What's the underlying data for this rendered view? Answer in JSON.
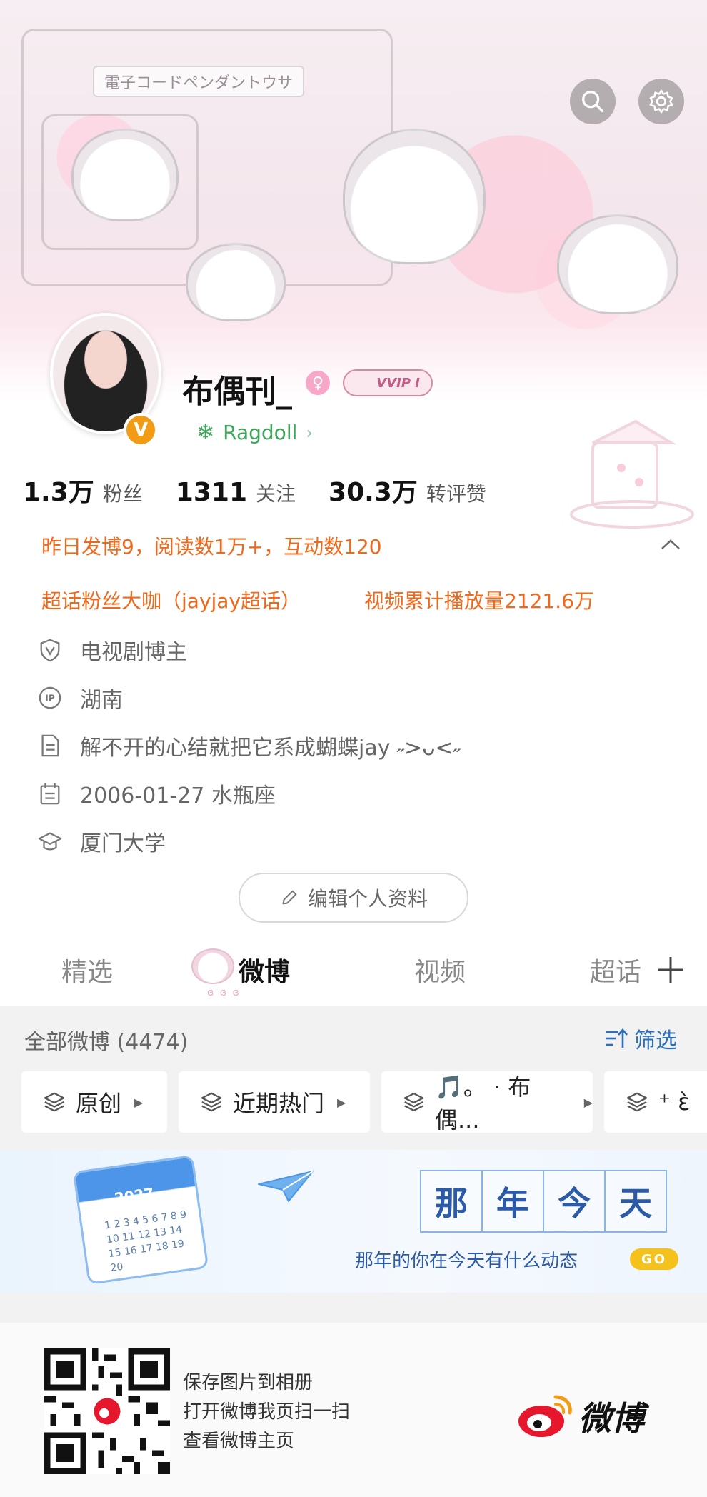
{
  "cover": {
    "caption": "電子コードペンダントウサ"
  },
  "profile": {
    "username": "布偶刊_",
    "gender_symbol": "♀",
    "vip_label": "VVIP I",
    "verified_badge": "V",
    "group_name": "Ragdoll",
    "group_icon": "❄",
    "group_chevron": "›"
  },
  "stats": [
    {
      "value": "1.3万",
      "label": "粉丝"
    },
    {
      "value": "1311",
      "label": "关注"
    },
    {
      "value": "30.3万",
      "label": "转评赞"
    }
  ],
  "highlights": {
    "yesterday": "昨日发博9，阅读数1万+，互动数120",
    "super_topic": "超话粉丝大咖（jayjay超话）",
    "video_plays": "视频累计播放量2121.6万"
  },
  "info": {
    "category": "电视剧博主",
    "location": "湖南",
    "bio": "解不开的心结就把它系成蝴蝶jay ˶>ᴗ<˶",
    "birthday": "2006-01-27 水瓶座",
    "school": "厦门大学"
  },
  "edit_button": "编辑个人资料",
  "tabs": [
    "精选",
    "微博",
    "视频",
    "超话"
  ],
  "tab_deco_text": "ɞ ɞ ɞ",
  "feed": {
    "count_label": "全部微博 (4474)",
    "filter_label": "筛选",
    "chips": [
      "原创",
      "近期热门",
      "🎵。 · 布偶...",
      "⁺ ɛ̀"
    ]
  },
  "banner": {
    "year": "2027",
    "calendar_numbers": "1 2 3 4 5 6 7 8 9 10 11 12 13 14 15 16 17 18 19 20",
    "title_chars": [
      "那",
      "年",
      "今",
      "天"
    ],
    "subtitle": "那年的你在今天有什么动态",
    "go_label": "GO"
  },
  "qr_card": {
    "lines": [
      "保存图片到相册",
      "打开微博我页扫一扫",
      "查看微博主页"
    ],
    "logo_text": "微博"
  },
  "colors": {
    "accent_orange": "#f0681a",
    "link_blue": "#2d6fb9",
    "group_green": "#3ea75c",
    "verified_orange": "#f29b14",
    "go_yellow": "#f5c21b"
  }
}
